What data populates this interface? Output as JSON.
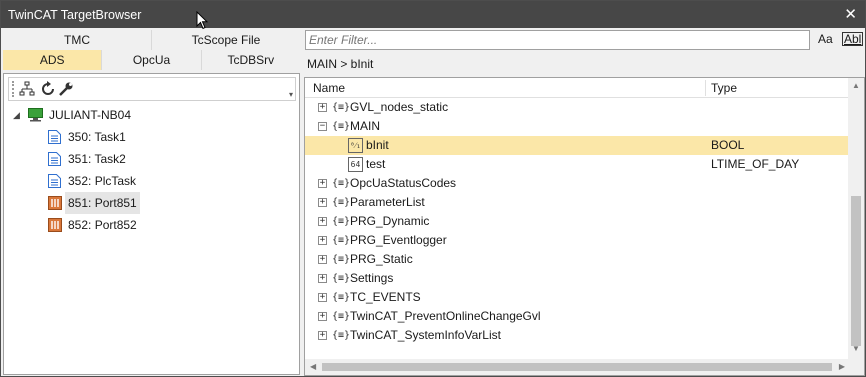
{
  "window": {
    "title": "TwinCAT TargetBrowser",
    "close_glyph": "✕"
  },
  "left": {
    "tabs_row1": [
      "TMC",
      "TcScope File"
    ],
    "tabs_row2": [
      "ADS",
      "OpcUa",
      "TcDBSrv"
    ],
    "active_tab": "ADS",
    "toolbar_icons": [
      "tree-view-icon",
      "refresh-icon",
      "wrench-icon"
    ],
    "tree": {
      "root": {
        "label": "JULIANT-NB04",
        "icon": "computer-icon",
        "expanded": true
      },
      "children": [
        {
          "label": "350: Task1",
          "icon": "task-icon"
        },
        {
          "label": "351: Task2",
          "icon": "task-icon"
        },
        {
          "label": "352: PlcTask",
          "icon": "task-icon"
        },
        {
          "label": "851: Port851",
          "icon": "plc-port-icon",
          "selected": true
        },
        {
          "label": "852: Port852",
          "icon": "plc-port-icon"
        }
      ]
    }
  },
  "right": {
    "filter_placeholder": "Enter Filter...",
    "match_case_label": "Aa",
    "whole_word_label": "Abl",
    "breadcrumb": "MAIN > bInit",
    "columns": {
      "name": "Name",
      "type": "Type"
    },
    "rows": [
      {
        "name": "GVL_nodes_static",
        "type": "",
        "level": 0,
        "expander": "+",
        "icon": "{≡}"
      },
      {
        "name": "MAIN",
        "type": "",
        "level": 0,
        "expander": "−",
        "icon": "{≡}"
      },
      {
        "name": "bInit",
        "type": "BOOL",
        "level": 1,
        "expander": "",
        "icon": "⁰⁄₁",
        "selected": true
      },
      {
        "name": "test",
        "type": "LTIME_OF_DAY",
        "level": 1,
        "expander": "",
        "icon": "64"
      },
      {
        "name": "OpcUaStatusCodes",
        "type": "",
        "level": 0,
        "expander": "+",
        "icon": "{≡}"
      },
      {
        "name": "ParameterList",
        "type": "",
        "level": 0,
        "expander": "+",
        "icon": "{≡}"
      },
      {
        "name": "PRG_Dynamic",
        "type": "",
        "level": 0,
        "expander": "+",
        "icon": "{≡}"
      },
      {
        "name": "PRG_Eventlogger",
        "type": "",
        "level": 0,
        "expander": "+",
        "icon": "{≡}"
      },
      {
        "name": "PRG_Static",
        "type": "",
        "level": 0,
        "expander": "+",
        "icon": "{≡}"
      },
      {
        "name": "Settings",
        "type": "",
        "level": 0,
        "expander": "+",
        "icon": "{≡}"
      },
      {
        "name": "TC_EVENTS",
        "type": "",
        "level": 0,
        "expander": "+",
        "icon": "{≡}"
      },
      {
        "name": "TwinCAT_PreventOnlineChangeGvl",
        "type": "",
        "level": 0,
        "expander": "+",
        "icon": "{≡}"
      },
      {
        "name": "TwinCAT_SystemInfoVarList",
        "type": "",
        "level": 0,
        "expander": "+",
        "icon": "{≡}"
      }
    ]
  },
  "colors": {
    "selection": "#fbe7a8",
    "titlebar": "#474747",
    "plc_port": "#d9773a",
    "task": "#2f6fcf",
    "computer": "#3aa13a"
  }
}
